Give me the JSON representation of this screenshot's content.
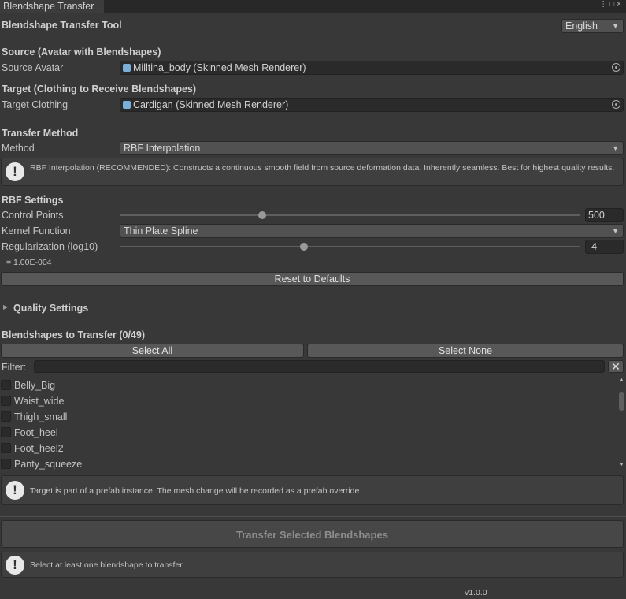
{
  "window": {
    "tab": "Blendshape Transfer"
  },
  "header": {
    "title": "Blendshape Transfer Tool",
    "language": "English"
  },
  "source": {
    "heading": "Source (Avatar with Blendshapes)",
    "label": "Source Avatar",
    "value": "Milltina_body (Skinned Mesh Renderer)"
  },
  "target": {
    "heading": "Target (Clothing to Receive Blendshapes)",
    "label": "Target Clothing",
    "value": "Cardigan (Skinned Mesh Renderer)"
  },
  "method": {
    "heading": "Transfer Method",
    "label": "Method",
    "value": "RBF Interpolation",
    "help": "RBF Interpolation (RECOMMENDED): Constructs a continuous smooth field from source deformation data. Inherently seamless. Best for highest quality results."
  },
  "rbf": {
    "heading": "RBF Settings",
    "control_points_label": "Control Points",
    "control_points_value": "500",
    "control_points_fraction": 0.31,
    "kernel_label": "Kernel Function",
    "kernel_value": "Thin Plate Spline",
    "reg_label": "Regularization (log10)",
    "reg_value": "-4",
    "reg_fraction": 0.4,
    "reg_readout": "= 1.00E-004",
    "reset": "Reset to Defaults"
  },
  "quality": {
    "heading": "Quality Settings"
  },
  "blendshapes": {
    "heading": "Blendshapes to Transfer (0/49)",
    "select_all": "Select All",
    "select_none": "Select None",
    "filter_label": "Filter:",
    "filter_value": "",
    "items": [
      "Belly_Big",
      "Waist_wide",
      "Thigh_small",
      "Foot_heel",
      "Foot_heel2",
      "Panty_squeeze"
    ],
    "prefab_help": "Target is part of a prefab instance. The mesh change will be recorded as a prefab override."
  },
  "transfer": {
    "button": "Transfer Selected Blendshapes",
    "help": "Select at least one blendshape to transfer."
  },
  "footer": {
    "version": "v1.0.0"
  }
}
